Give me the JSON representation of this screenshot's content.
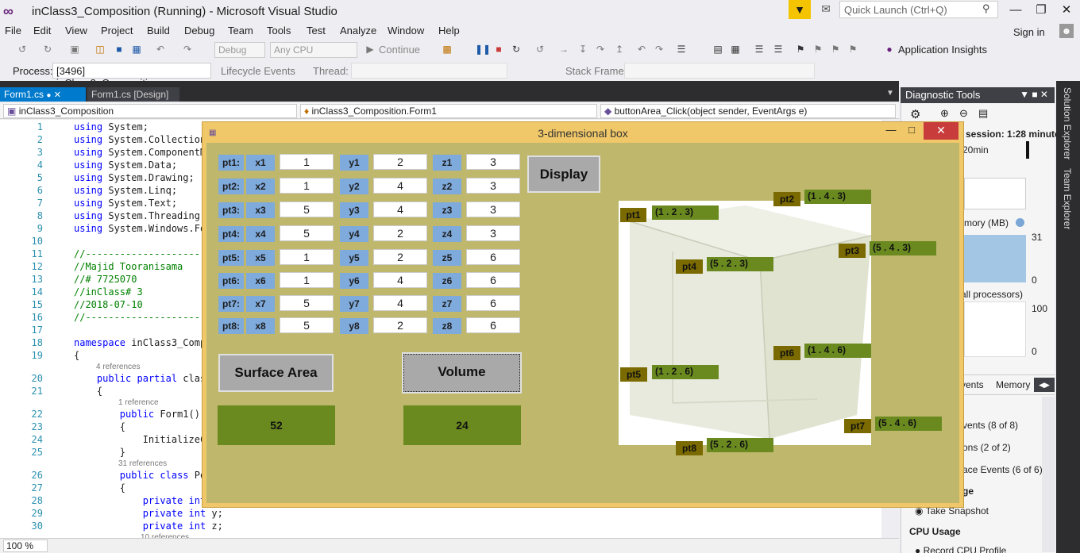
{
  "vs": {
    "title": "inClass3_Composition (Running) - Microsoft Visual Studio",
    "quick_launch_placeholder": "Quick Launch (Ctrl+Q)",
    "menu": [
      "File",
      "Edit",
      "View",
      "Project",
      "Build",
      "Debug",
      "Team",
      "Tools",
      "Test",
      "Analyze",
      "Window",
      "Help"
    ],
    "sign_in": "Sign in",
    "toolbar": {
      "config": "Debug",
      "platform": "Any CPU",
      "continue": "Continue",
      "app_insights": "Application Insights"
    },
    "process": {
      "label": "Process:",
      "value": "[3496] inClass3_Composition.exe",
      "lifecycle": "Lifecycle Events",
      "thread_label": "Thread:",
      "stack_frame_label": "Stack Frame:"
    },
    "tabs": [
      "Form1.cs",
      "Form1.cs [Design]"
    ],
    "nav": {
      "project": "inClass3_Composition",
      "type": "inClass3_Composition.Form1",
      "member": "buttonArea_Click(object sender, EventArgs e)"
    },
    "zoom": "100 %"
  },
  "code": [
    {
      "n": "1",
      "t": "using System;"
    },
    {
      "n": "2",
      "t": "using System.Collection"
    },
    {
      "n": "3",
      "t": "using System.ComponentM"
    },
    {
      "n": "4",
      "t": "using System.Data;"
    },
    {
      "n": "5",
      "t": "using System.Drawing;"
    },
    {
      "n": "6",
      "t": "using System.Linq;"
    },
    {
      "n": "7",
      "t": "using System.Text;"
    },
    {
      "n": "8",
      "t": "using System.Threading."
    },
    {
      "n": "9",
      "t": "using System.Windows.Fo"
    },
    {
      "n": "10",
      "t": ""
    },
    {
      "n": "11",
      "t": "//---------------------"
    },
    {
      "n": "12",
      "t": "//Majid Tooranisama"
    },
    {
      "n": "13",
      "t": "//# 7725070"
    },
    {
      "n": "14",
      "t": "//inClass# 3"
    },
    {
      "n": "15",
      "t": "//2018-07-10"
    },
    {
      "n": "16",
      "t": "//---------------------"
    },
    {
      "n": "17",
      "t": ""
    },
    {
      "n": "18",
      "t": "namespace inClass3_Comp"
    },
    {
      "n": "19",
      "t": "{"
    },
    {
      "n": "20",
      "t": "    public partial clas"
    },
    {
      "n": "21",
      "t": "    {"
    },
    {
      "n": "22",
      "t": "        public Form1()"
    },
    {
      "n": "23",
      "t": "        {"
    },
    {
      "n": "24",
      "t": "            InitializeC"
    },
    {
      "n": "25",
      "t": "        }"
    },
    {
      "n": "26",
      "t": "        public class Po"
    },
    {
      "n": "27",
      "t": "        {"
    },
    {
      "n": "28",
      "t": "            private int"
    },
    {
      "n": "29",
      "t": "            private int y;"
    },
    {
      "n": "30",
      "t": "            private int z;"
    }
  ],
  "code_refs": [
    "4 references",
    "1 reference",
    "31 references",
    "10 references"
  ],
  "diag": {
    "title": "Diagnostic Tools",
    "session": "session: 1:28 minutes",
    "timeline": "20min",
    "memory_label": "mory (MB)",
    "mem_max": "31",
    "mem_min": "0",
    "cpu_label": "all processors)",
    "cpu_max": "100",
    "cpu_min": "0",
    "tabs": [
      "vents",
      "Memory"
    ],
    "events": "vents (8 of 8)",
    "exceptions": "ons (2 of 2)",
    "trace_events": "ace Events (6 of 6)",
    "usage": "ge",
    "take_snapshot": "Take Snapshot",
    "cpu_usage": "CPU Usage",
    "record_cpu": "Record CPU Profile"
  },
  "side_panel": [
    "Solution Explorer",
    "Team Explorer"
  ],
  "form": {
    "title": "3-dimensional box",
    "points": [
      {
        "pt": "pt1:",
        "xl": "x1",
        "x": "1",
        "yl": "y1",
        "y": "2",
        "zl": "z1",
        "z": "3"
      },
      {
        "pt": "pt2:",
        "xl": "x2",
        "x": "1",
        "yl": "y2",
        "y": "4",
        "zl": "z2",
        "z": "3"
      },
      {
        "pt": "pt3:",
        "xl": "x3",
        "x": "5",
        "yl": "y3",
        "y": "4",
        "zl": "z3",
        "z": "3"
      },
      {
        "pt": "pt4:",
        "xl": "x4",
        "x": "5",
        "yl": "y4",
        "y": "2",
        "zl": "z4",
        "z": "3"
      },
      {
        "pt": "pt5:",
        "xl": "x5",
        "x": "1",
        "yl": "y5",
        "y": "2",
        "zl": "z5",
        "z": "6"
      },
      {
        "pt": "pt6:",
        "xl": "x6",
        "x": "1",
        "yl": "y6",
        "y": "4",
        "zl": "z6",
        "z": "6"
      },
      {
        "pt": "pt7:",
        "xl": "x7",
        "x": "5",
        "yl": "y7",
        "y": "4",
        "zl": "z7",
        "z": "6"
      },
      {
        "pt": "pt8:",
        "xl": "x8",
        "x": "5",
        "yl": "y8",
        "y": "2",
        "zl": "z8",
        "z": "6"
      }
    ],
    "display_button": "Display",
    "surface_area_button": "Surface Area",
    "volume_button": "Volume",
    "surface_area_result": "52",
    "volume_result": "24",
    "labels": [
      {
        "name": "pt1",
        "value": "(1 . 2 . 3)"
      },
      {
        "name": "pt2",
        "value": "(1 . 4 . 3)"
      },
      {
        "name": "pt3",
        "value": "(5 . 4 . 3)"
      },
      {
        "name": "pt4",
        "value": "(5 . 2 . 3)"
      },
      {
        "name": "pt5",
        "value": "(1 . 2 . 6)"
      },
      {
        "name": "pt6",
        "value": "(1 . 4 . 6)"
      },
      {
        "name": "pt7",
        "value": "(5 . 4 . 6)"
      },
      {
        "name": "pt8",
        "value": "(5 . 2 . 6)"
      }
    ]
  },
  "colors": {
    "form_bg": "#beb76c",
    "label_blue": "#7eaadc",
    "result_green": "#6a8a20",
    "pt_name_olive": "#7a6a00",
    "vs_accent": "#007acc"
  }
}
